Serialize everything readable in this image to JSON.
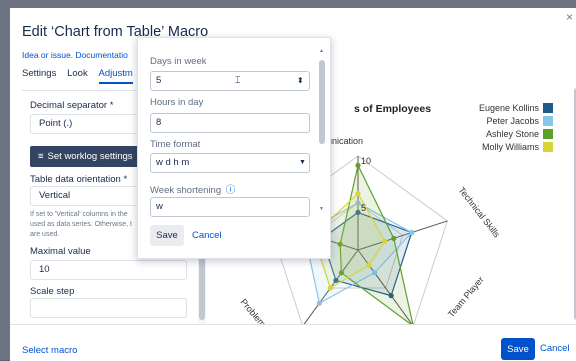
{
  "dialog": {
    "title": "Edit ‘Chart from Table’ Macro"
  },
  "left": {
    "idea_text": "Idea or issue. Documentatio",
    "tabs": [
      {
        "label": "Settings"
      },
      {
        "label": "Look"
      },
      {
        "label": "Adjustm"
      }
    ],
    "decimal_label": "Decimal separator *",
    "decimal_value": "Point (.)",
    "worklog_button": "Set worklog settings",
    "orientation_label": "Table data orientation *",
    "orientation_value": "Vertical",
    "help_lines": [
      "If set to 'Vertical' columns in the",
      "used as data series. Otherwise, t",
      "are used."
    ],
    "maximal_label": "Maximal value",
    "maximal_value": "10",
    "scale_label": "Scale step",
    "scale_value": ""
  },
  "popup": {
    "days_label": "Days in week",
    "days_value": "5",
    "hours_label": "Hours in day",
    "hours_value": "8",
    "time_format_label": "Time format",
    "time_format_value": "w d h m",
    "week_short_label": "Week shortening",
    "week_short_value": "w",
    "save": "Save",
    "cancel": "Cancel"
  },
  "footer": {
    "select_macro": "Select macro",
    "save": "Save",
    "cancel": "Cancel"
  },
  "chart_data": {
    "type": "radar",
    "title": "s of Employees",
    "axes": [
      "nunication",
      "Technical Skills",
      "Team Player",
      "",
      "Problem Solving"
    ],
    "radial_tick_labels": [
      "10",
      "5"
    ],
    "rmax": 10,
    "series": [
      {
        "name": "Eugene Kollins",
        "color": "#1f5b8a",
        "values": [
          4,
          6,
          6,
          4,
          4
        ]
      },
      {
        "name": "Peter Jacobs",
        "color": "#89c4e9",
        "values": [
          5,
          6,
          3,
          7,
          6
        ]
      },
      {
        "name": "Ashley Stone",
        "color": "#5fa02c",
        "values": [
          9,
          4,
          10,
          3,
          2
        ]
      },
      {
        "name": "Molly Williams",
        "color": "#d7d43a",
        "values": [
          6,
          3,
          2,
          5,
          5
        ]
      }
    ]
  },
  "icons": {
    "close": "close-icon",
    "stepper": "stepper-icon",
    "help": "help-icon"
  }
}
